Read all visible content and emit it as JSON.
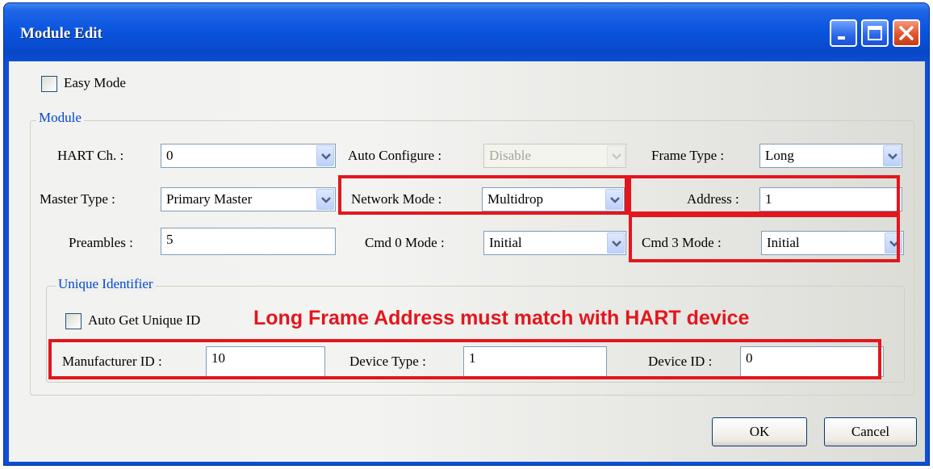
{
  "window": {
    "title": "Module Edit"
  },
  "easy_mode": {
    "label": "Easy Mode",
    "checked": false
  },
  "module_group": {
    "legend": "Module",
    "hart_ch": {
      "label": "HART Ch. :",
      "value": "0"
    },
    "auto_configure": {
      "label": "Auto Configure :",
      "value": "Disable",
      "disabled": true
    },
    "frame_type": {
      "label": "Frame Type :",
      "value": "Long"
    },
    "master_type": {
      "label": "Master Type :",
      "value": "Primary Master"
    },
    "network_mode": {
      "label": "Network Mode :",
      "value": "Multidrop"
    },
    "address": {
      "label": "Address :",
      "value": "1"
    },
    "preambles": {
      "label": "Preambles :",
      "value": "5"
    },
    "cmd0_mode": {
      "label": "Cmd 0 Mode :",
      "value": "Initial"
    },
    "cmd3_mode": {
      "label": "Cmd 3 Mode :",
      "value": "Initial"
    }
  },
  "unique_group": {
    "legend": "Unique Identifier",
    "auto_get": {
      "label": "Auto Get Unique ID",
      "checked": false
    },
    "manufacturer_id": {
      "label": "Manufacturer ID :",
      "value": "10"
    },
    "device_type": {
      "label": "Device Type :",
      "value": "1"
    },
    "device_id": {
      "label": "Device ID :",
      "value": "0"
    }
  },
  "annotation": "Long Frame Address must match with HART device",
  "buttons": {
    "ok": "OK",
    "cancel": "Cancel"
  },
  "colors": {
    "highlight": "#e3161d",
    "titlebar": "#0b55e0",
    "legend": "#0046d5"
  }
}
